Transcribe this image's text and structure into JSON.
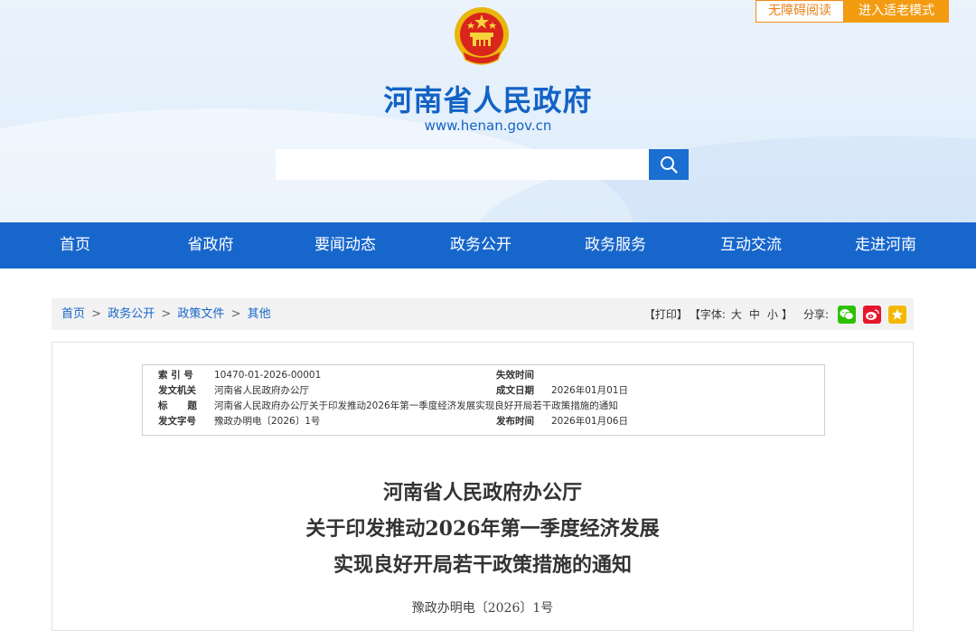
{
  "header": {
    "accessible_label": "无障碍阅读",
    "elder_mode_label": "进入适老模式",
    "site_title": "河南省人民政府",
    "site_url": "www.henan.gov.cn",
    "search_placeholder": ""
  },
  "nav": {
    "items": [
      "首页",
      "省政府",
      "要闻动态",
      "政务公开",
      "政务服务",
      "互动交流",
      "走进河南"
    ]
  },
  "breadcrumb": {
    "items": [
      "首页",
      "政务公开",
      "政策文件",
      "其他"
    ],
    "separator": ">"
  },
  "tools": {
    "print": "【打印】",
    "font_label": "【字体:",
    "font_large": "大",
    "font_medium": "中",
    "font_small": "小",
    "font_close": "】",
    "share_label": "分享:"
  },
  "meta": {
    "index_label": "索 引 号",
    "index_value": "10470-01-2026-00001",
    "expire_label": "失效时间",
    "expire_value": "",
    "issuer_label": "发文机关",
    "issuer_value": "河南省人民政府办公厅",
    "written_label": "成文日期",
    "written_value": "2026年01月01日",
    "title_label": "标      题",
    "title_value": "河南省人民政府办公厅关于印发推动2026年第一季度经济发展实现良好开局若干政策措施的通知",
    "docno_label": "发文字号",
    "docno_value": "豫政办明电〔2026〕1号",
    "publish_label": "发布时间",
    "publish_value": "2026年01月06日"
  },
  "document": {
    "title_line1": "河南省人民政府办公厅",
    "title_line2": "关于印发推动2026年第一季度经济发展",
    "title_line3": "实现良好开局若干政策措施的通知",
    "doc_number": "豫政办明电〔2026〕1号"
  },
  "colors": {
    "brand_blue": "#1766cc",
    "accent_orange": "#f39c12",
    "wechat_green": "#2dc100",
    "weibo_red": "#e6162d",
    "qzone_yellow": "#f5b800"
  }
}
